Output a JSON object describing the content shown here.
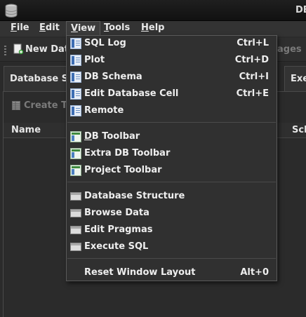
{
  "window": {
    "title": "DB"
  },
  "menubar": {
    "file": {
      "u": "F",
      "rest": "ile"
    },
    "edit": {
      "u": "E",
      "rest": "dit"
    },
    "view": {
      "u": "V",
      "rest": "iew"
    },
    "tools": {
      "u": "T",
      "rest": "ools"
    },
    "help": {
      "u": "H",
      "rest": "elp"
    }
  },
  "toolbar": {
    "new_database": "New Data",
    "right_fragment": "ages"
  },
  "tabs": {
    "database_structure": "Database Stru",
    "execute": "Exe"
  },
  "structure": {
    "create_table": "Create Tab",
    "col_name": "Name",
    "col_schema": "Sch"
  },
  "view_menu": {
    "items": [
      {
        "label": "SQL Log",
        "shortcut": "Ctrl+L",
        "icon": "panel-icon"
      },
      {
        "label": "Plot",
        "shortcut": "Ctrl+D",
        "icon": "panel-icon"
      },
      {
        "label": "DB Schema",
        "shortcut": "Ctrl+I",
        "icon": "panel-icon"
      },
      {
        "label": "Edit Database Cell",
        "shortcut": "Ctrl+E",
        "icon": "panel-icon"
      },
      {
        "label": "Remote",
        "shortcut": "",
        "icon": "panel-icon"
      },
      {
        "label_u": "D",
        "label_rest": "B Toolbar",
        "shortcut": "",
        "icon": "toolbar-icon"
      },
      {
        "label": "Extra DB Toolbar",
        "shortcut": "",
        "icon": "toolbar-icon"
      },
      {
        "label": "Project Toolbar",
        "shortcut": "",
        "icon": "toolbar-icon"
      },
      {
        "label": "Database Structure",
        "shortcut": "",
        "icon": "tab-icon"
      },
      {
        "label": "Browse Data",
        "shortcut": "",
        "icon": "tab-icon"
      },
      {
        "label": "Edit Pragmas",
        "shortcut": "",
        "icon": "tab-icon"
      },
      {
        "label": "Execute SQL",
        "shortcut": "",
        "icon": "tab-icon"
      },
      {
        "label": "Reset Window Layout",
        "shortcut": "Alt+0",
        "icon": ""
      }
    ]
  },
  "colors": {
    "background": "#2b2b2b",
    "menu_background": "#303030",
    "text": "#eeeeee",
    "disabled_text": "#7a7a7a",
    "accent_blue": "#3d6db3"
  }
}
